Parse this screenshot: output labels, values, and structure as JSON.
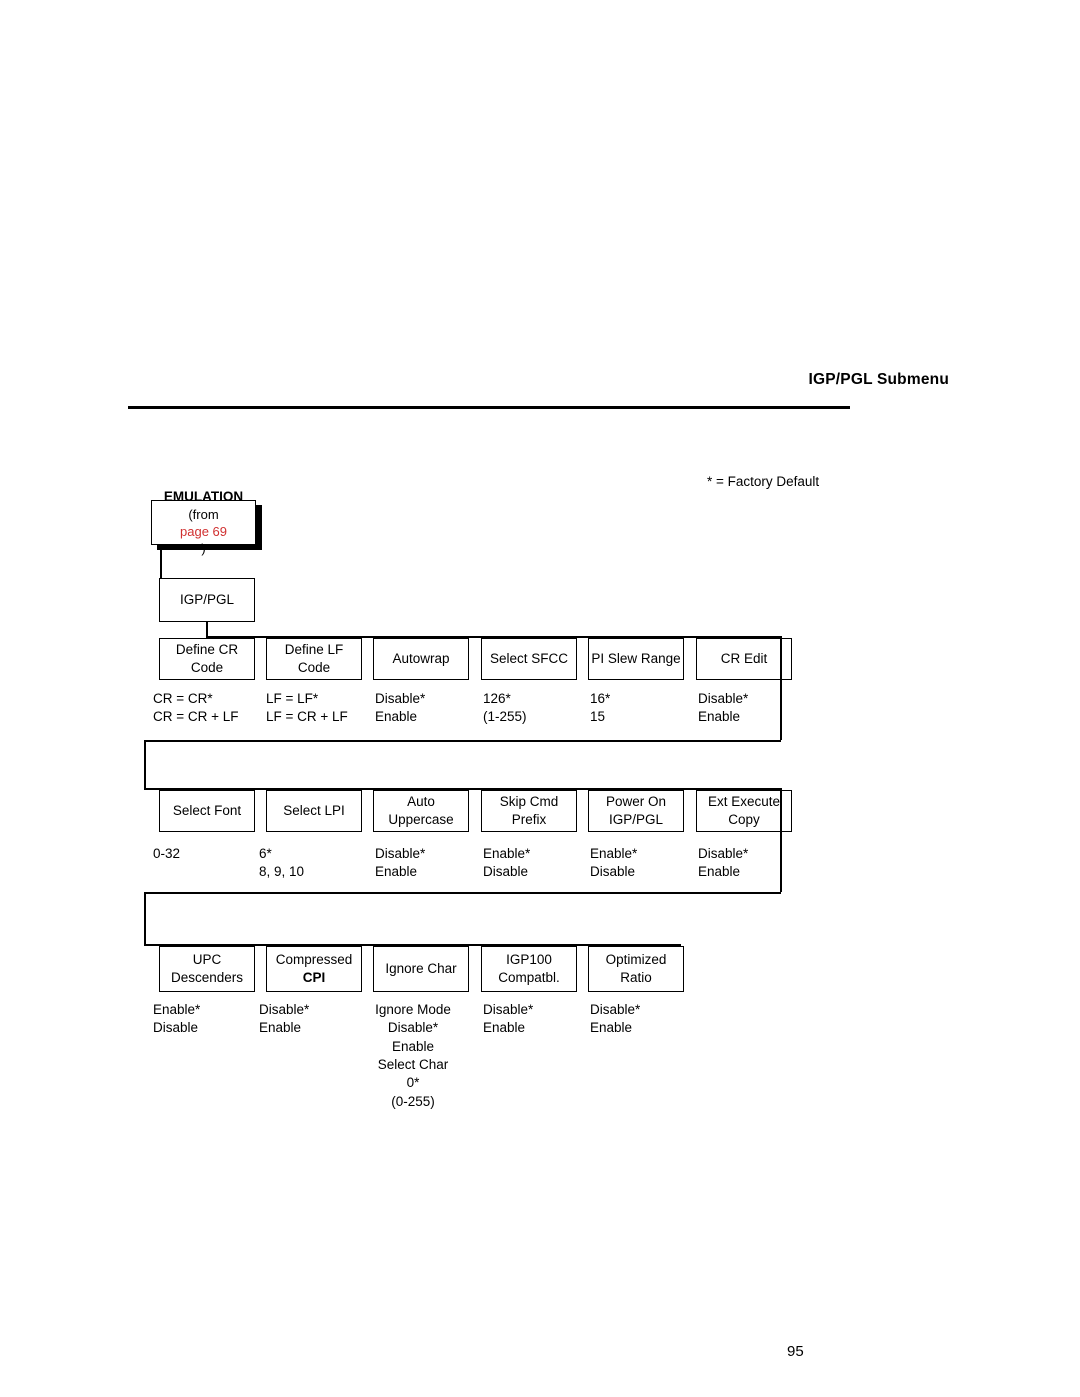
{
  "header": {
    "title": "IGP/PGL Submenu"
  },
  "footer": {
    "page_number": "95"
  },
  "legend": {
    "factory_default": "* = Factory Default"
  },
  "diagram": {
    "entry": {
      "title": "EMULATION",
      "from_prefix": "(from ",
      "from_link": "page 69",
      "from_suffix": ")"
    },
    "root": {
      "label": "IGP/PGL"
    },
    "rows": [
      {
        "nodes": [
          {
            "name": "define-cr-code",
            "line1": "Define CR",
            "line2": "Code",
            "options": [
              "CR = CR*",
              "CR = CR + LF"
            ]
          },
          {
            "name": "define-lf-code",
            "line1": "Define LF",
            "line2": "Code",
            "options": [
              "LF = LF*",
              "LF = CR + LF"
            ]
          },
          {
            "name": "autowrap",
            "line1": "Autowrap",
            "line2": "",
            "options": [
              "Disable*",
              "Enable"
            ]
          },
          {
            "name": "select-sfcc",
            "line1": "Select SFCC",
            "line2": "",
            "options": [
              "126*",
              "(1-255)"
            ]
          },
          {
            "name": "pi-slew-range",
            "line1": "PI Slew Range",
            "line2": "",
            "options": [
              "16*",
              "15"
            ]
          },
          {
            "name": "cr-edit",
            "line1": "CR Edit",
            "line2": "",
            "options": [
              "Disable*",
              "Enable"
            ]
          }
        ]
      },
      {
        "nodes": [
          {
            "name": "select-font",
            "line1": "Select Font",
            "line2": "",
            "options": [
              "0-32"
            ]
          },
          {
            "name": "select-lpi",
            "line1": "Select LPI",
            "line2": "",
            "options": [
              "6*",
              "8, 9, 10"
            ]
          },
          {
            "name": "auto-uppercase",
            "line1": "Auto",
            "line2": "Uppercase",
            "options": [
              "Disable*",
              "Enable"
            ]
          },
          {
            "name": "skip-cmd-prefix",
            "line1": "Skip Cmd",
            "line2": "Prefix",
            "options": [
              "Enable*",
              "Disable"
            ]
          },
          {
            "name": "power-on-igp-pgl",
            "line1": "Power On",
            "line2": "IGP/PGL",
            "options": [
              "Enable*",
              "Disable"
            ]
          },
          {
            "name": "ext-execute-copy",
            "line1": "Ext Execute",
            "line2": "Copy",
            "options": [
              "Disable*",
              "Enable"
            ]
          }
        ]
      },
      {
        "nodes": [
          {
            "name": "upc-descenders",
            "line1": "UPC",
            "line2": "Descenders",
            "options": [
              "Enable*",
              "Disable"
            ]
          },
          {
            "name": "compressed-cpi",
            "line1": "Compressed",
            "line2": "CPI",
            "options": [
              "Disable*",
              "Enable"
            ]
          },
          {
            "name": "ignore-char",
            "line1": "Ignore Char",
            "line2": "",
            "options": [
              "Ignore Mode",
              "Disable*",
              "Enable",
              "Select Char",
              "0*",
              "(0-255)"
            ]
          },
          {
            "name": "igp100-compatbl",
            "line1": "IGP100",
            "line2": "Compatbl.",
            "options": [
              "Disable*",
              "Enable"
            ]
          },
          {
            "name": "optimized-ratio",
            "line1": "Optimized",
            "line2": "Ratio",
            "options": [
              "Disable*",
              "Enable"
            ]
          }
        ]
      }
    ]
  }
}
